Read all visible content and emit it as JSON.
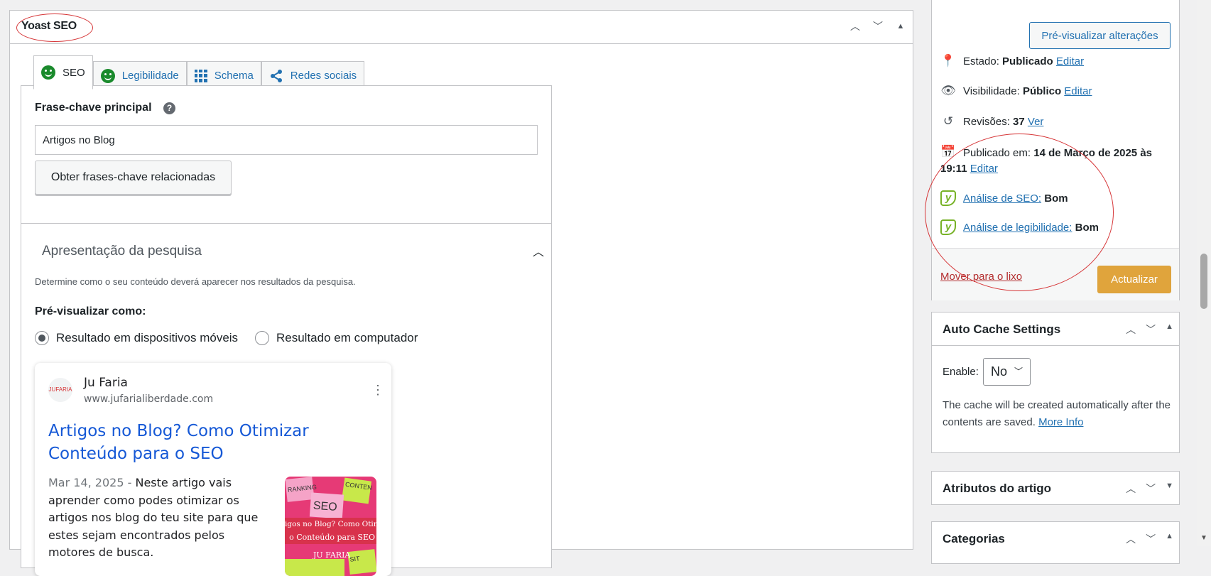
{
  "yoast": {
    "title": "Yoast SEO",
    "tabs": [
      {
        "label": "SEO",
        "icon": "smile-icon"
      },
      {
        "label": "Legibilidade",
        "icon": "smile-icon"
      },
      {
        "label": "Schema",
        "icon": "grid-icon"
      },
      {
        "label": "Redes sociais",
        "icon": "share-icon"
      }
    ],
    "keyphrase_label": "Frase-chave principal",
    "keyphrase_value": "Artigos no Blog",
    "related_button": "Obter frases-chave relacionadas",
    "search_appearance_title": "Apresentação da pesquisa",
    "search_appearance_desc": "Determine como o seu conteúdo deverá aparecer nos resultados da pesquisa.",
    "preview_as_label": "Pré-visualizar como:",
    "radio_mobile": "Resultado em dispositivos móveis",
    "radio_desktop": "Resultado em computador",
    "selected_preview": "mobile"
  },
  "serp": {
    "favicon_text": "JUFARIA",
    "site_name": "Ju Faria",
    "url": "www.jufarialiberdade.com",
    "title": "Artigos no Blog? Como Otimizar Conteúdo para o SEO",
    "date": "Mar 14, 2025",
    "separator": " - ",
    "description": "Neste artigo vais aprender como podes otimizar os artigos nos blog do teu site para que estes sejam encontrados pelos motores de busca.",
    "thumb_lines": [
      "igos no Blog? Como Otimi",
      "o Conteúdo para SEO",
      "JU FARIA"
    ],
    "thumb_notes": [
      "RANKING",
      "CONTEN",
      "SEO",
      "SIT"
    ]
  },
  "publish": {
    "preview_button": "Pré-visualizar alterações",
    "status_label": "Estado:",
    "status_value": "Publicado",
    "visibility_label": "Visibilidade:",
    "visibility_value": "Público",
    "revisions_label": "Revisões:",
    "revisions_value": "37",
    "revisions_link": "Ver",
    "published_label": "Publicado em:",
    "published_value_1": "14 de Março de 2025 às",
    "published_value_2": "19:11",
    "edit_link": "Editar",
    "seo_analysis_link": "Análise de SEO:",
    "seo_analysis_value": "Bom",
    "readability_link": "Análise de legibilidade:",
    "readability_value": "Bom",
    "trash_link": "Mover para o lixo",
    "update_button": "Actualizar"
  },
  "cache": {
    "title": "Auto Cache Settings",
    "enable_label": "Enable:",
    "enable_value": "No",
    "description": "The cache will be created automatically after the contents are saved.",
    "more_info": "More Info"
  },
  "attributes_title": "Atributos do artigo",
  "categories_title": "Categorias",
  "colors": {
    "accent": "#2271b1",
    "update_button": "#e0a43c",
    "annotation_circle": "#d63638",
    "good_green": "#1a8a2c",
    "yoast_green": "#77b227"
  }
}
